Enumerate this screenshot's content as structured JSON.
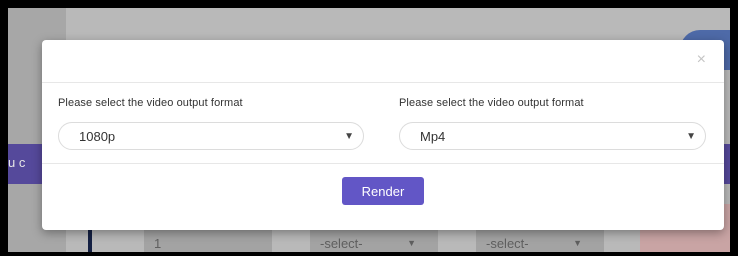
{
  "background": {
    "left_text": "u c",
    "row": {
      "number": "1",
      "select_a": "-select-",
      "select_b": "-select-",
      "arrow_icon": "▼"
    }
  },
  "modal": {
    "close_icon": "×",
    "resolution": {
      "label": "Please select the video output format",
      "value": "1080p",
      "arrow_icon": "▼"
    },
    "format": {
      "label": "Please select the video output format",
      "value": "Mp4",
      "arrow_icon": "▼"
    },
    "render_button": "Render"
  },
  "colors": {
    "primary_button": "#6256c6",
    "backdrop": "#b9b9b9",
    "background_band": "#55499b"
  }
}
